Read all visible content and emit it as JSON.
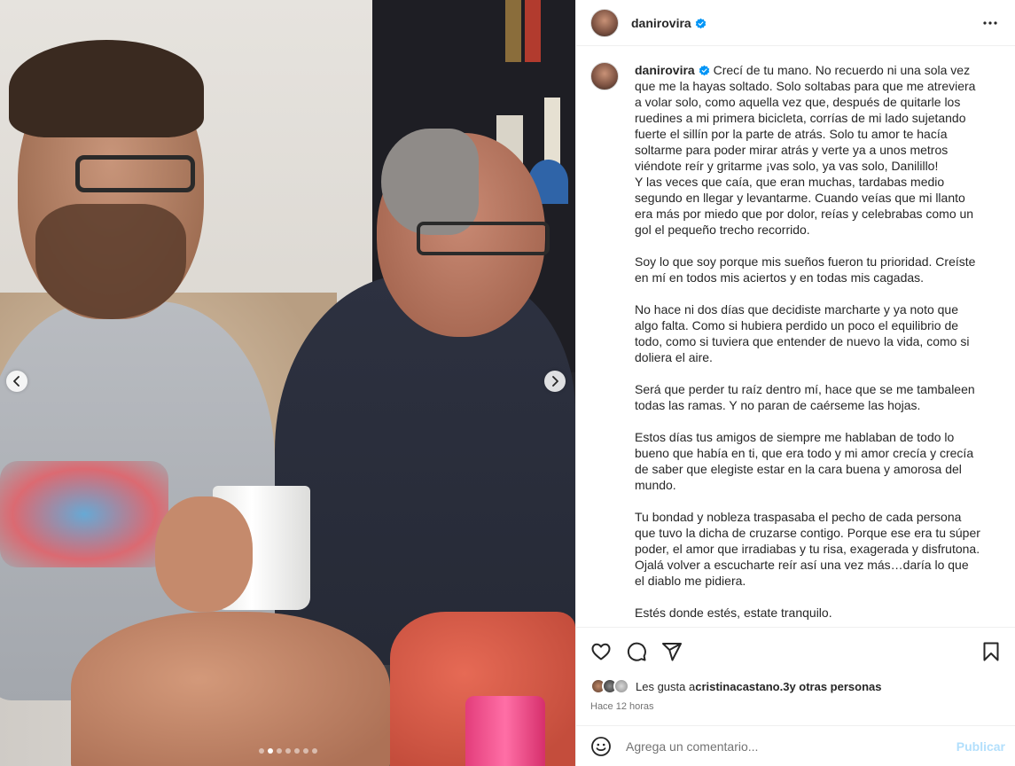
{
  "post": {
    "username": "danirovira",
    "caption": "Crecí de tu mano. No recuerdo ni una sola vez que me la hayas soltado. Solo soltabas para que me atreviera a volar solo, como aquella vez que, después de quitarle los ruedines a mi primera bicicleta, corrías de mi lado sujetando fuerte el sillín por la parte de atrás. Solo tu amor te hacía soltarme para poder mirar atrás y verte ya a unos metros viéndote reír y gritarme ¡vas solo, ya vas solo, Danilillo!\nY las veces que caía, que eran muchas, tardabas medio segundo en llegar y levantarme. Cuando veías que mi llanto era más por miedo que por dolor, reías y celebrabas como un gol el pequeño trecho recorrido.\n\nSoy lo que soy porque mis sueños fueron tu prioridad. Creíste en mí en todos mis aciertos y en todas mis cagadas.\n\nNo hace ni dos días que decidiste marcharte y ya noto que algo falta. Como si hubiera perdido un poco el equilibrio de todo, como si tuviera que entender de nuevo la vida, como si doliera el aire.\n\nSerá que perder tu raíz dentro mí, hace que se me tambaleen todas las ramas. Y no paran de caérseme las hojas.\n\nEstos días tus amigos de siempre me hablaban de todo lo bueno que había en ti, que era todo y mi amor crecía y crecía de saber que elegiste estar en la cara buena y amorosa del mundo.\n\nTu bondad y nobleza traspasaba el pecho de cada persona que tuvo la dicha de cruzarse contigo. Porque ese era tu súper poder, el amor que irradiabas y tu risa, exagerada y disfrutona. Ojalá volver a escucharte reír así una vez más…daría lo que el diablo me pidiera.\n\nEstés donde estés, estate tranquilo.\n\nAunque los que somos de aquí seguimos..."
  },
  "likes": {
    "prefix": "Les gusta a ",
    "user": "cristinacastano.3",
    "suffix": " y otras personas"
  },
  "timestamp": "Hace 12 horas",
  "comment": {
    "placeholder": "Agrega un comentario...",
    "publish_label": "Publicar"
  },
  "carousel": {
    "total_slides": 7,
    "active_index": 1
  },
  "colors": {
    "verified": "#0095f6",
    "publish_disabled": "#b2dffc",
    "muted_text": "#737373"
  }
}
